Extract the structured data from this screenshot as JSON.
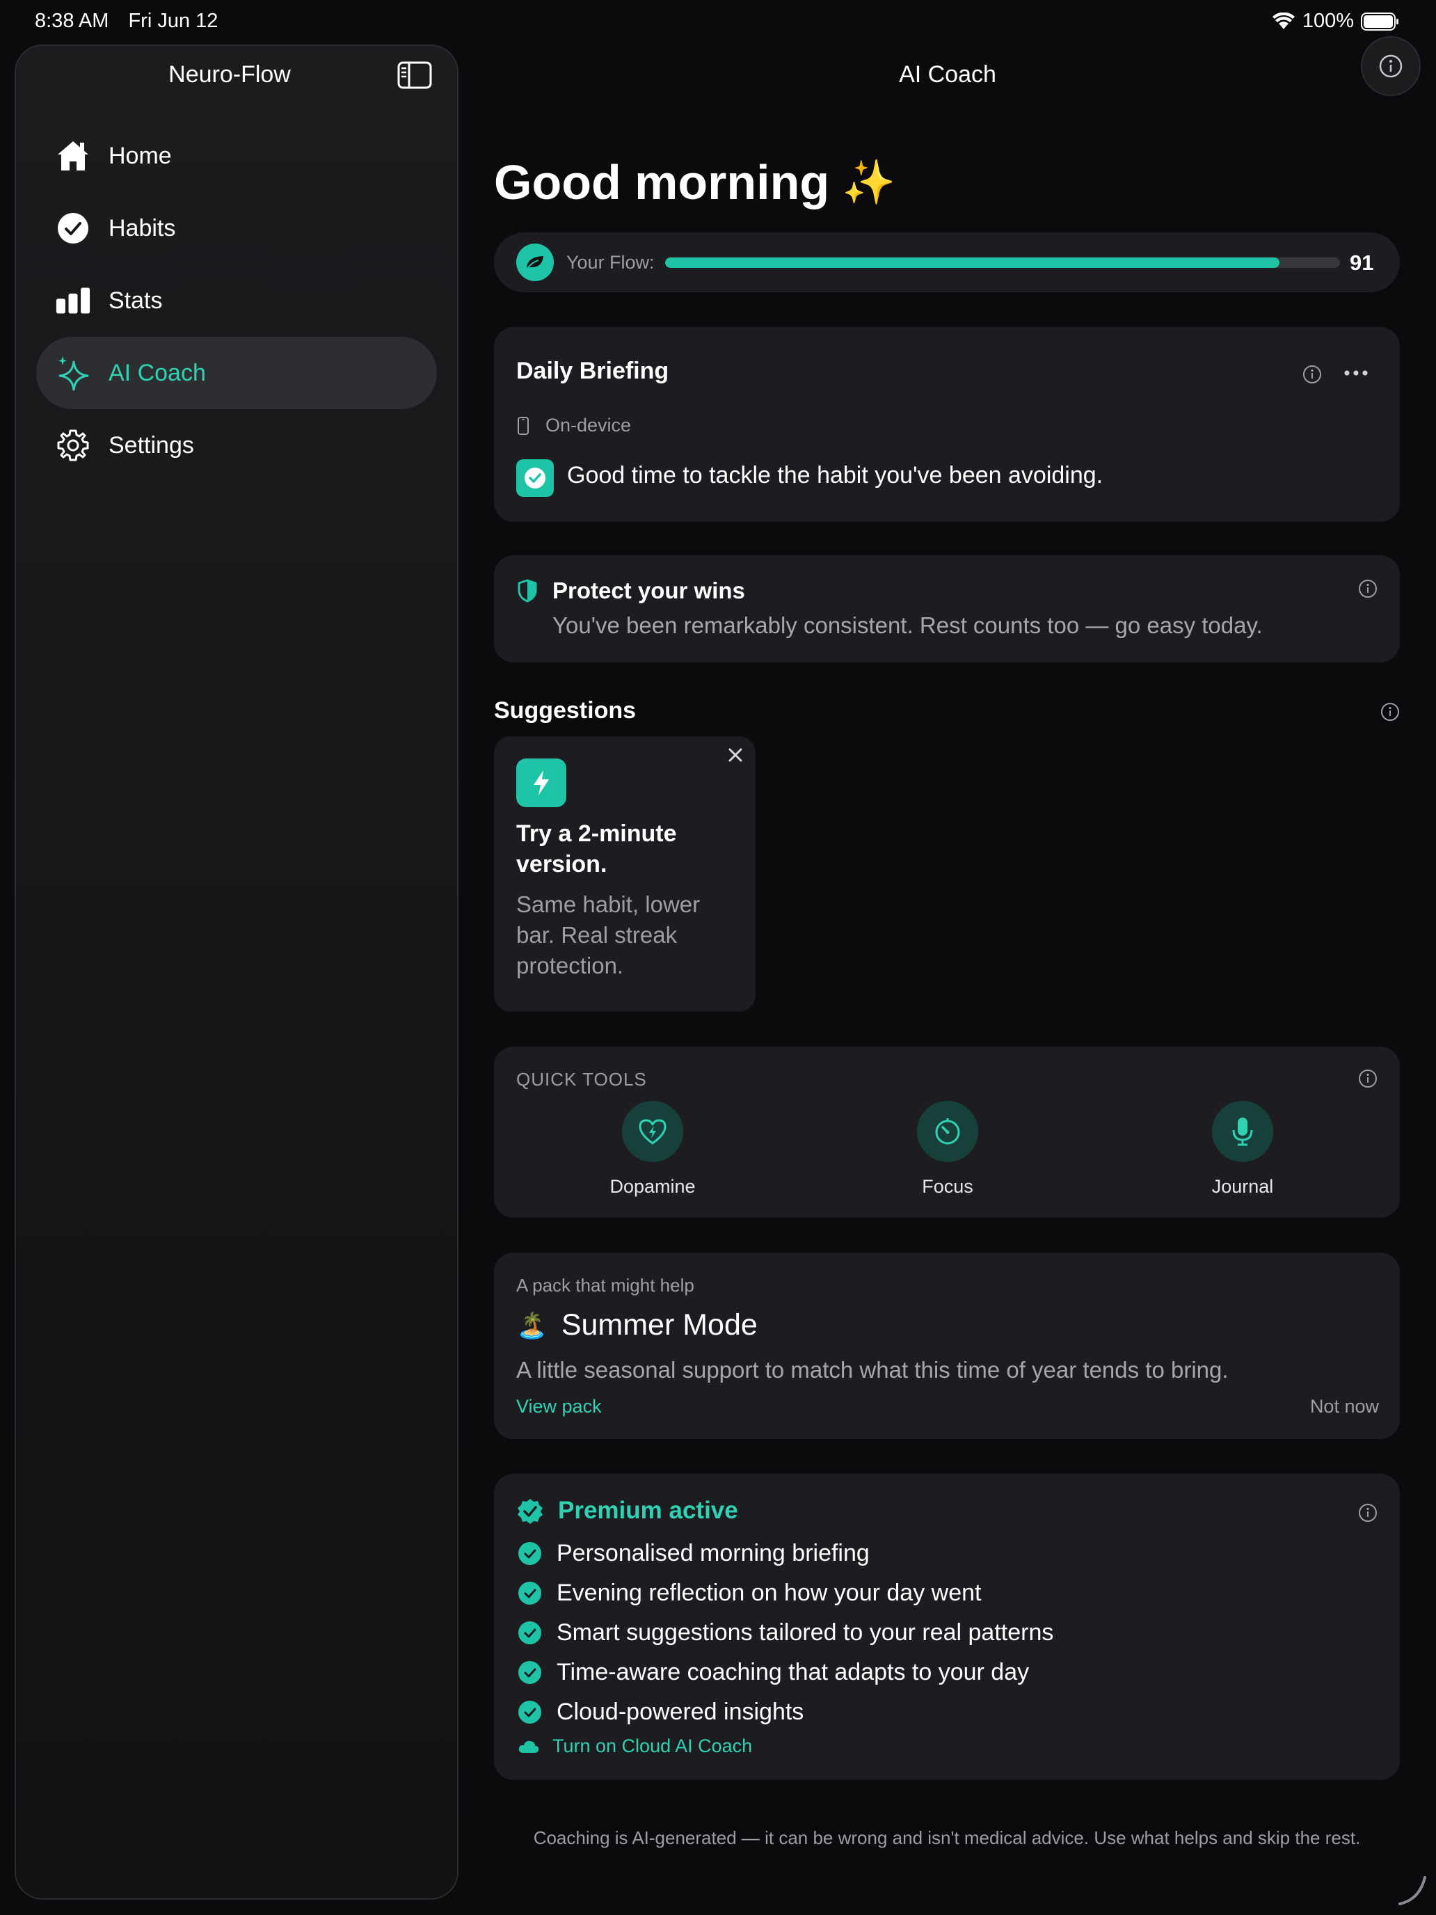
{
  "status_bar": {
    "time": "8:38 AM",
    "date": "Fri Jun 12",
    "battery": "100%"
  },
  "sidebar": {
    "title": "Neuro-Flow",
    "items": [
      {
        "label": "Home",
        "icon": "house-icon",
        "active": false
      },
      {
        "label": "Habits",
        "icon": "checkmark-circle-icon",
        "active": false
      },
      {
        "label": "Stats",
        "icon": "bar-chart-icon",
        "active": false
      },
      {
        "label": "AI Coach",
        "icon": "sparkles-icon",
        "active": true
      },
      {
        "label": "Settings",
        "icon": "gear-icon",
        "active": false
      }
    ]
  },
  "header": {
    "title": "AI Coach"
  },
  "greeting": {
    "text": "Good morning",
    "emoji": "✨"
  },
  "flow": {
    "label": "Your Flow:",
    "value": "91",
    "progress": 0.91
  },
  "briefing": {
    "title": "Daily Briefing",
    "source": "On-device",
    "message": "Good time to tackle the habit you've been avoiding."
  },
  "protect": {
    "title": "Protect your wins",
    "body": "You've been remarkably consistent. Rest counts too — go easy today."
  },
  "suggestions": {
    "heading": "Suggestions",
    "card": {
      "title_line1": "Try a 2-minute",
      "title_line2": "version.",
      "body_line1": "Same habit, lower",
      "body_line2": "bar. Real streak",
      "body_line3": "protection."
    }
  },
  "quick_tools": {
    "heading": "QUICK TOOLS",
    "tools": [
      {
        "label": "Dopamine",
        "icon": "heart-bolt-icon"
      },
      {
        "label": "Focus",
        "icon": "timer-icon"
      },
      {
        "label": "Journal",
        "icon": "microphone-icon"
      }
    ]
  },
  "pack": {
    "eyebrow": "A pack that might help",
    "emoji": "🏝️",
    "title": "Summer Mode",
    "body": "A little seasonal support to match what this time of year tends to bring.",
    "primary_action": "View pack",
    "secondary_action": "Not now"
  },
  "premium": {
    "title": "Premium active",
    "features": [
      "Personalised morning briefing",
      "Evening reflection on how your day went",
      "Smart suggestions tailored to your real patterns",
      "Time-aware coaching that adapts to your day",
      "Cloud-powered insights"
    ],
    "cloud_action": "Turn on Cloud AI Coach"
  },
  "disclaimer": "Coaching is AI-generated — it can be wrong and isn't medical advice. Use what helps and skip the rest.",
  "colors": {
    "accent": "#1fc4a6",
    "background": "#0b0b0d",
    "card": "#1d1d21"
  }
}
